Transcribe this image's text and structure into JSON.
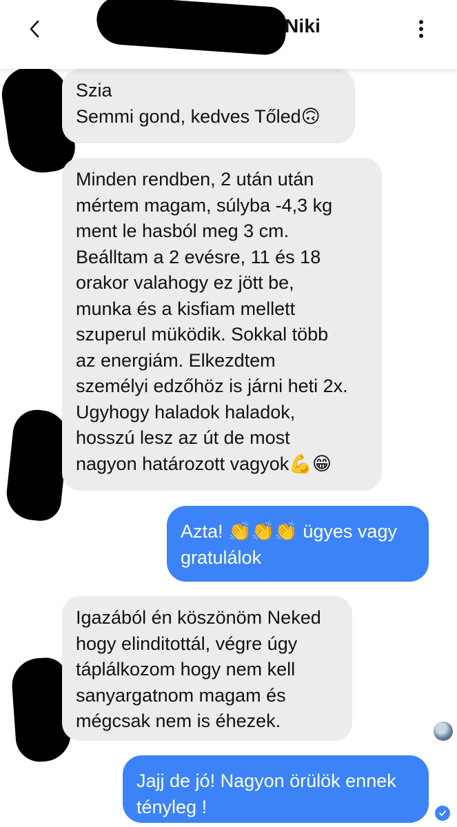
{
  "header": {
    "contact_name": "Niki",
    "back_icon": "chevron-left-icon",
    "more_icon": "vertical-dots-icon"
  },
  "colors": {
    "outgoing_bubble": "#3b83f6",
    "incoming_bubble": "#ececec",
    "background": "#ffffff"
  },
  "messages": [
    {
      "direction": "incoming",
      "text": "Szia\nSemmi gond, kedves Tőled🙃"
    },
    {
      "direction": "incoming",
      "text": "Minden rendben, 2 után után\nmértem magam, súlyba -4,3 kg\nment le hasból meg 3 cm.\nBeálltam a 2 evésre, 11 és 18\norakor valahogy ez jött be,\nmunka és a kisfiam mellett\nszuperul müködik. Sokkal több\naz energiám. Elkezdtem\nszemélyi edzőhöz is járni heti 2x.\nUgyhogy haladok haladok,\nhosszú lesz az út de most\nnagyon határozott vagyok💪😁"
    },
    {
      "direction": "outgoing",
      "text": "Azta! 👏👏👏 ügyes vagy\ngratulálok"
    },
    {
      "direction": "incoming",
      "text": "Igazából én köszönöm Neked\nhogy elinditottál, végre úgy\ntáplálkozom hogy nem kell\nsanyargatnom magam és\nmégcsak nem is éhezek."
    },
    {
      "direction": "outgoing",
      "text": "Jajj de jó! Nagyon örülök ennek\ntényleg !"
    }
  ]
}
